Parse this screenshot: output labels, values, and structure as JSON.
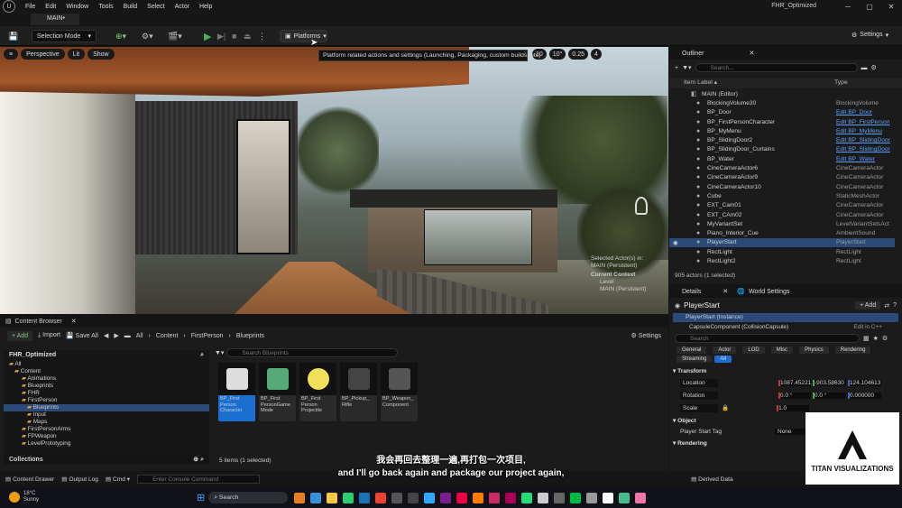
{
  "menubar": {
    "items": [
      "File",
      "Edit",
      "Window",
      "Tools",
      "Build",
      "Select",
      "Actor",
      "Help"
    ],
    "project": "FHR_Optimized",
    "tab": "MAIN•"
  },
  "toolbar": {
    "selection_mode": "Selection Mode",
    "platforms": "Platforms",
    "settings": "Settings"
  },
  "tooltip": "Platform related actions and settings (Launching, Packaging, custom builds, etc)",
  "viewport": {
    "perspective": "Perspective",
    "lit": "Lit",
    "show": "Show",
    "grid": "10",
    "angle": "10°",
    "scale": "0.25",
    "cam": "4",
    "overlay": [
      "Selected Actor(s) in:",
      "MAIN (Persistent)",
      "Current Context",
      "Level",
      "MAIN (Persistent)"
    ]
  },
  "outliner": {
    "title": "Outliner",
    "search": "Search...",
    "col_label": "Item Label",
    "col_type": "Type",
    "rows": [
      {
        "name": "MAIN (Editor)",
        "type": ""
      },
      {
        "name": "BlockingVolume30",
        "type": "BlockingVolume"
      },
      {
        "name": "BP_Door",
        "type": "Edit BP_Door"
      },
      {
        "name": "BP_FirstPersonCharacter",
        "type": "Edit BP_FirstPerson"
      },
      {
        "name": "BP_MyMenu",
        "type": "Edit BP_MyMenu"
      },
      {
        "name": "BP_SlidingDoor2",
        "type": "Edit BP_SlidingDoor"
      },
      {
        "name": "BP_SlidingDoor_Curtains",
        "type": "Edit BP_SlidingDoor"
      },
      {
        "name": "BP_Water",
        "type": "Edit BP_Water"
      },
      {
        "name": "CineCameraActor6",
        "type": "CineCameraActor"
      },
      {
        "name": "CineCameraActor9",
        "type": "CineCameraActor"
      },
      {
        "name": "CineCameraActor10",
        "type": "CineCameraActor"
      },
      {
        "name": "Cube",
        "type": "StaticMeshActor"
      },
      {
        "name": "EXT_Cam01",
        "type": "CineCameraActor"
      },
      {
        "name": "EXT_CAm02",
        "type": "CineCameraActor"
      },
      {
        "name": "MyVariantSet",
        "type": "LevelVariantSetsAct"
      },
      {
        "name": "Piano_Interior_Cue",
        "type": "AmbientSound"
      },
      {
        "name": "PlayerStart",
        "type": "PlayerStart"
      },
      {
        "name": "RectLight",
        "type": "RectLight"
      },
      {
        "name": "RectLight2",
        "type": "RectLight"
      }
    ],
    "count": "905 actors (1 selected)"
  },
  "details": {
    "tab1": "Details",
    "tab2": "World Settings",
    "actor": "PlayerStart",
    "add": "+ Add",
    "instance": "PlayerStart (Instance)",
    "component": "CapsuleComponent (CollisionCapsule)",
    "edit_cpp": "Edit in C++",
    "search": "Search",
    "filters": [
      "General",
      "Actor",
      "LOD",
      "Misc",
      "Physics",
      "Rendering",
      "Streaming",
      "All"
    ],
    "transform": "Transform",
    "location": "Location",
    "rotation": "Rotation",
    "scale": "Scale",
    "loc_vals": [
      "1087.45221",
      "-903.58630",
      "124.104613"
    ],
    "rot_vals": [
      "0.0 °",
      "0.0 °",
      "0.000000"
    ],
    "scale_val": "1.0",
    "object": "Object",
    "tag_label": "Player Start Tag",
    "tag_val": "None",
    "rendering": "Rendering"
  },
  "content_browser": {
    "title": "Content Browser",
    "add": "+ Add",
    "import": "Import",
    "save_all": "Save All",
    "path": [
      "All",
      "Content",
      "FirstPerson",
      "Blueprints"
    ],
    "settings": "Settings",
    "search": "Search Blueprints",
    "tree_root": "FHR_Optimized",
    "tree": [
      "All",
      "Content",
      "Animations",
      "Blueprints",
      "FHR",
      "FirstPerson",
      "Blueprints",
      "Input",
      "Maps",
      "FirstPersonArms",
      "FPWeapon",
      "LevelPrototyping"
    ],
    "assets": [
      "BP_First Person Character",
      "BP_First PersonGame Mode",
      "BP_First Person Projectile",
      "BP_Pickup_ Rifle",
      "BP_Weapon_ Component"
    ],
    "status": "5 items (1 selected)",
    "collections": "Collections"
  },
  "statusbar": {
    "content_drawer": "Content Drawer",
    "output_log": "Output Log",
    "cmd": "Cmd",
    "console": "Enter Console Command",
    "derived": "Derived Data"
  },
  "subtitle": {
    "zh": "我会再回去整理一遍,再打包一次项目,",
    "en": "and I'll go back again and package our project again,"
  },
  "watermark": {
    "text": "TITAN VISUALIZATIONS"
  },
  "taskbar": {
    "temp": "18°C",
    "weather": "Sunny",
    "search": "Search"
  }
}
